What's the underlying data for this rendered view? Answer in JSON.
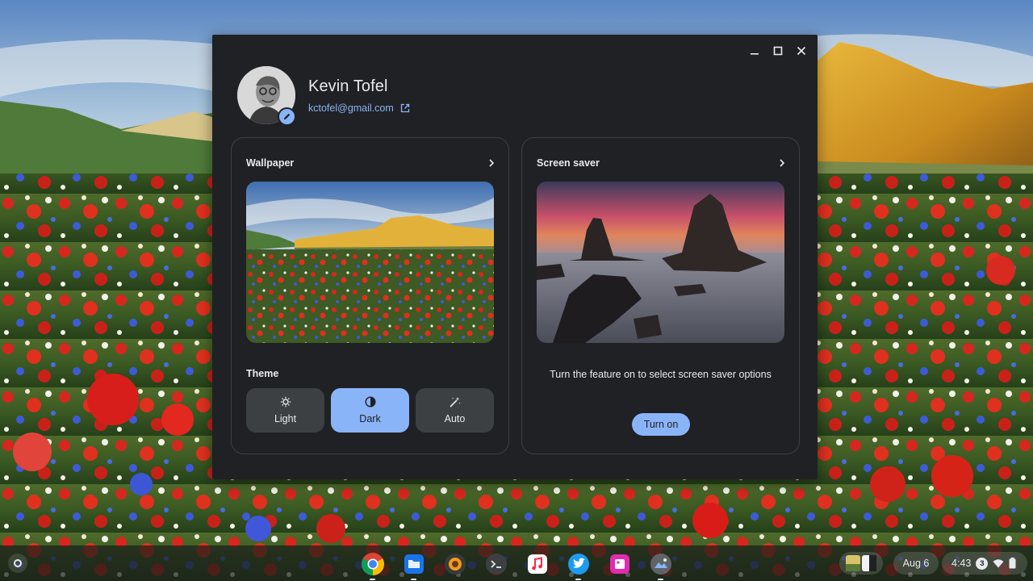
{
  "profile": {
    "name": "Kevin Tofel",
    "email": "kctofel@gmail.com"
  },
  "wallpaper_card": {
    "title": "Wallpaper"
  },
  "theme": {
    "label": "Theme",
    "options": [
      {
        "label": "Light",
        "icon": "brightness-icon",
        "selected": false
      },
      {
        "label": "Dark",
        "icon": "contrast-icon",
        "selected": true
      },
      {
        "label": "Auto",
        "icon": "magic-wand-icon",
        "selected": false
      }
    ]
  },
  "screensaver_card": {
    "title": "Screen saver",
    "message": "Turn the feature on to select screen saver options",
    "button_label": "Turn on"
  },
  "shelf": {
    "apps": [
      "chrome",
      "files",
      "sunflower-app",
      "terminal",
      "youtube-music",
      "twitter",
      "photo-app",
      "camera-app"
    ],
    "date": "Aug 6",
    "time": "4:43",
    "notification_count": "3"
  },
  "colors": {
    "accent": "#8ab4f8",
    "window_bg": "#202124",
    "button_bg": "#3c4043"
  }
}
